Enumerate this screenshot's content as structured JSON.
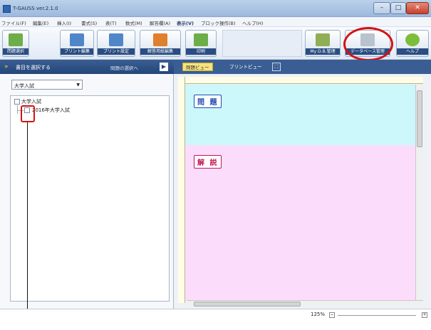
{
  "app": {
    "title": "T-GAUSS ver.2.1.0"
  },
  "window_controls": {
    "minimize": "–",
    "maximize": "□",
    "close": "✕"
  },
  "menu": [
    "ファイル(F)",
    "編集(E)",
    "挿入(I)",
    "書式(S)",
    "表(T)",
    "数式(M)",
    "解答欄(A)",
    "表示(V)",
    "ブロック操作(B)",
    "ヘルプ(H)"
  ],
  "toolbar": {
    "problem_select": "問題選択",
    "print_edit": "プリント編集",
    "print_settings": "プリント設定",
    "answer_edit": "解答用紙編集",
    "print": "印刷",
    "my_db": "My D.B.管理",
    "database": "データベース管理",
    "help": "ヘルプ"
  },
  "left_panel": {
    "header": "書目を選択する",
    "header_right": "問題の選択へ",
    "select_value": "大学入試",
    "tree": {
      "root": "大学入試",
      "child": "2016年大学入試"
    }
  },
  "right_panel": {
    "tabs": {
      "problem_view": "問題ビュー",
      "print_view": "プリントビュー"
    },
    "problem_label": "問 題",
    "explanation_label": "解 説"
  },
  "status": {
    "zoom": "125%"
  },
  "colors": {
    "highlight": "#d31212",
    "problem_bg": "#ccf7fb",
    "explanation_bg": "#fcdcfb",
    "tab_active": "#f6e37a"
  }
}
